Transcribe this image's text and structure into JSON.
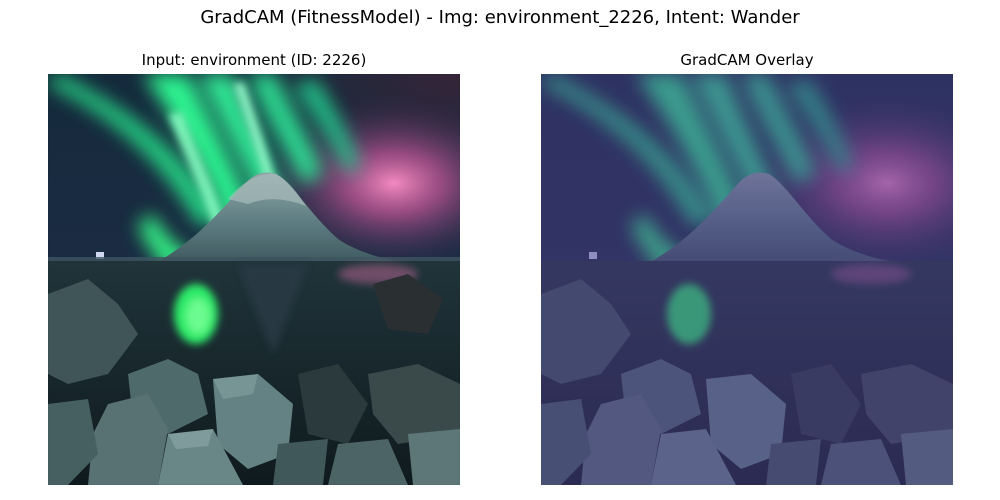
{
  "figure": {
    "title": "GradCAM (FitnessModel) - Img: environment_2226, Intent: Wander"
  },
  "panels": [
    {
      "title": "Input: environment (ID: 2226)"
    },
    {
      "title": "GradCAM Overlay"
    }
  ],
  "colors": {
    "sky_top": "#15243a",
    "aurora_green": "#2bff8c",
    "aurora_pink": "#ff5fa8",
    "mountain": "#5c7e82",
    "water": "#16242a",
    "rocks": "#4f6869",
    "overlay_tint": "#4b3c8c"
  }
}
